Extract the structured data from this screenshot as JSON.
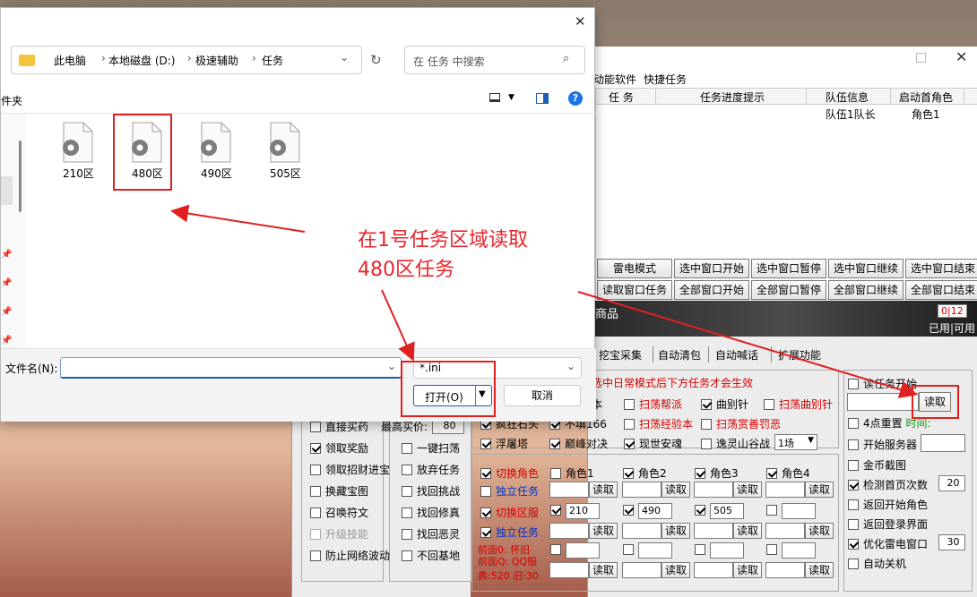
{
  "dialog": {
    "breadcrumb": [
      "此电脑",
      "本地磁盘 (D:)",
      "极速辅助",
      "任务"
    ],
    "search_placeholder": "在 任务 中搜索",
    "left_label": "件夹",
    "files": [
      {
        "name": "210区"
      },
      {
        "name": "480区"
      },
      {
        "name": "490区"
      },
      {
        "name": "505区"
      }
    ],
    "filename_label": "文件名(N):",
    "filename_value": "",
    "filetype_value": "*.ini",
    "open_label": "打开(O)",
    "cancel_label": "取消"
  },
  "annotation": {
    "line1": "在1号任务区域读取",
    "line2": "480区任务"
  },
  "app": {
    "menu": [
      "动能软件",
      "快捷任务"
    ],
    "table_headers": [
      "任 务",
      "任务进度提示",
      "队伍信息",
      "启动首角色"
    ],
    "table_row": {
      "team": "队伍1队长",
      "role": "角色1"
    },
    "ctrl_row1": [
      "雷电模式",
      "选中窗口开始",
      "选中窗口暂停",
      "选中窗口继续",
      "选中窗口结束"
    ],
    "ctrl_row2": [
      "读取窗口任务",
      "全部窗口开始",
      "全部窗口暂停",
      "全部窗口继续",
      "全部窗口结束"
    ],
    "shop_text": "商品",
    "counter": "0|12",
    "used_text": "已用|可用",
    "tabs": [
      "挖宝采集",
      "自动清包",
      "自动喊话",
      "扩展功能"
    ],
    "notice": "选中日常模式后下方任务才会生效",
    "opts_r1": [
      {
        "label": "本",
        "checked": false
      },
      {
        "label": "扫荡帮派",
        "checked": false
      },
      {
        "label": "曲别针",
        "checked": true
      },
      {
        "label": "扫荡曲别针",
        "checked": false
      }
    ],
    "opts_r2": [
      {
        "label": "疯狂石头",
        "checked": true
      },
      {
        "label": "不填166",
        "checked": true
      },
      {
        "label": "扫荡经验本",
        "checked": false
      },
      {
        "label": "扫荡赏善罚恶",
        "checked": false
      }
    ],
    "opts_r3": [
      {
        "label": "浮屠塔",
        "checked": true
      },
      {
        "label": "巅峰对决",
        "checked": true
      },
      {
        "label": "现世安魂",
        "checked": true
      },
      {
        "label": "逸灵山谷战",
        "checked": false
      }
    ],
    "battle_select": "1场",
    "left_col": [
      {
        "label": "直接买药",
        "checked": false
      },
      {
        "label": "领取奖励",
        "checked": true
      },
      {
        "label": "领取招财进宝",
        "checked": false
      },
      {
        "label": "换藏宝图",
        "checked": false
      },
      {
        "label": "召唤符文",
        "checked": false
      },
      {
        "label": "升级技能",
        "checked": false
      },
      {
        "label": "防止网络波动",
        "checked": false
      }
    ],
    "max_price_label": "最高买价:",
    "max_price_value": "80",
    "mid_col": [
      {
        "label": "一键扫荡",
        "checked": false
      },
      {
        "label": "放弃任务",
        "checked": false
      },
      {
        "label": "找回挑战",
        "checked": false
      },
      {
        "label": "找回修真",
        "checked": false
      },
      {
        "label": "找回恶灵",
        "checked": false
      },
      {
        "label": "不回基地",
        "checked": false
      }
    ],
    "switch_role": "切换角色",
    "indep_task": "独立任务",
    "switch_zone": "切换区服",
    "roles": [
      {
        "label": "角色1",
        "checked": false
      },
      {
        "label": "角色2",
        "checked": true
      },
      {
        "label": "角色3",
        "checked": true
      },
      {
        "label": "角色4",
        "checked": true
      }
    ],
    "zones": [
      {
        "value": "210",
        "checked": true
      },
      {
        "value": "490",
        "checked": true
      },
      {
        "value": "505",
        "checked": true
      },
      {
        "value": "",
        "checked": false
      }
    ],
    "read_label": "读取",
    "front0": "前面0: 怀旧",
    "frontq": "前面Q: QQ服",
    "dian": "典:520  旧:30",
    "right_col": [
      {
        "label": "读任务开始",
        "checked": false
      },
      {
        "label": "4点重置",
        "checked": false,
        "extra": "时间:"
      },
      {
        "label": "开始服务器",
        "checked": false
      },
      {
        "label": "金币截图",
        "checked": false
      },
      {
        "label": "检测首页次数",
        "checked": true,
        "value": "20"
      },
      {
        "label": "返回开始角色",
        "checked": false
      },
      {
        "label": "返回登录界面",
        "checked": false
      },
      {
        "label": "优化雷电窗口",
        "checked": true,
        "value": "30"
      },
      {
        "label": "自动关机",
        "checked": false
      }
    ],
    "read_btn": "读取"
  }
}
